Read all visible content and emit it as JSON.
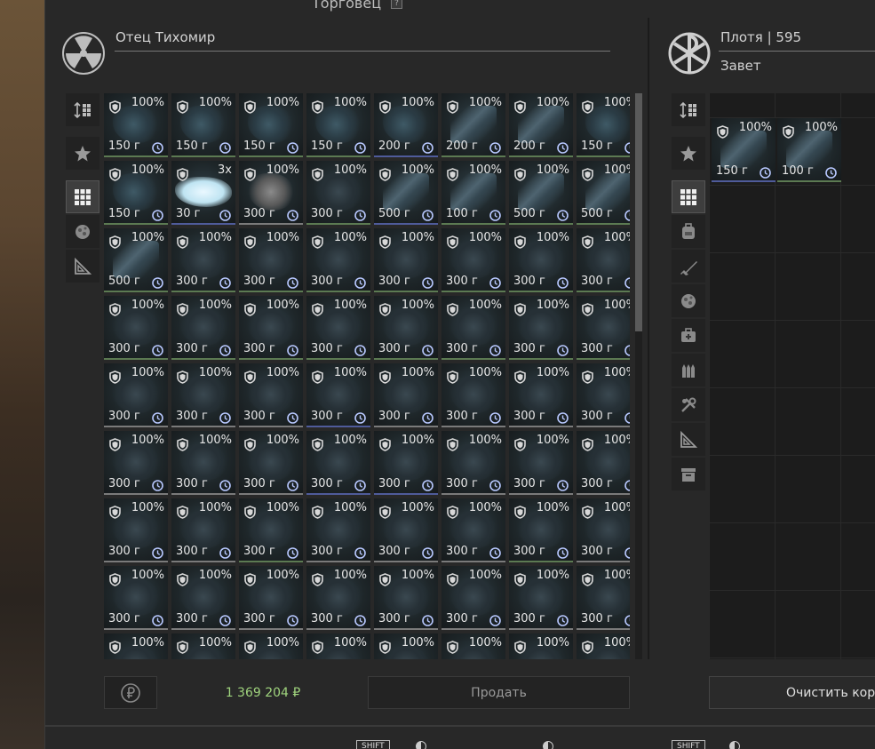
{
  "window": {
    "title": "Торговец",
    "help": "?"
  },
  "trader": {
    "name": "Отец Тихомир"
  },
  "player": {
    "name": "Плотя | 595",
    "faction": "Завет"
  },
  "colors": {
    "money": "#9fd37d",
    "rarity_green": "#5c7a52",
    "rarity_blue": "#4f5b9a"
  },
  "trader_tabs": [
    {
      "icon": "sort-icon",
      "active": false
    },
    {
      "icon": "star-badge-icon",
      "active": false
    },
    {
      "icon": "grid-icon",
      "active": true
    },
    {
      "icon": "artifact-icon",
      "active": false
    },
    {
      "icon": "ruler-triangle-icon",
      "active": false
    }
  ],
  "player_tabs": [
    {
      "icon": "sort-icon",
      "active": false
    },
    {
      "icon": "star-badge-icon",
      "active": false
    },
    {
      "icon": "grid-icon",
      "active": true
    },
    {
      "icon": "backpack-icon",
      "active": false
    },
    {
      "icon": "rifle-icon",
      "active": false
    },
    {
      "icon": "artifact-icon",
      "active": false
    },
    {
      "icon": "medkit-icon",
      "active": false
    },
    {
      "icon": "ammo-icon",
      "active": false
    },
    {
      "icon": "tools-icon",
      "active": false
    },
    {
      "icon": "ruler-triangle-icon",
      "active": false
    },
    {
      "icon": "box-icon",
      "active": false
    }
  ],
  "trader_items": [
    {
      "pct": "100%",
      "wt": "150 г",
      "art": "",
      "rar": "green"
    },
    {
      "pct": "100%",
      "wt": "150 г",
      "art": "",
      "rar": "green"
    },
    {
      "pct": "100%",
      "wt": "150 г",
      "art": "",
      "rar": "green"
    },
    {
      "pct": "100%",
      "wt": "150 г",
      "art": "",
      "rar": "green"
    },
    {
      "pct": "100%",
      "wt": "200 г",
      "art": "",
      "rar": "blue"
    },
    {
      "pct": "100%",
      "wt": "200 г",
      "art": "blade",
      "rar": "green"
    },
    {
      "pct": "100%",
      "wt": "200 г",
      "art": "blade",
      "rar": "green"
    },
    {
      "pct": "100%",
      "wt": "150 г",
      "art": "",
      "rar": "green"
    },
    {
      "pct": "100%",
      "wt": "150 г",
      "art": "",
      "rar": "green"
    },
    {
      "pct": "3x",
      "wt": "30 г",
      "art": "salt",
      "rar": "blue"
    },
    {
      "pct": "100%",
      "wt": "300 г",
      "art": "haze",
      "rar": "white"
    },
    {
      "pct": "100%",
      "wt": "300 г",
      "art": "dark",
      "rar": "green"
    },
    {
      "pct": "100%",
      "wt": "500 г",
      "art": "blade",
      "rar": "blue"
    },
    {
      "pct": "100%",
      "wt": "100 г",
      "art": "blade",
      "rar": "green"
    },
    {
      "pct": "100%",
      "wt": "500 г",
      "art": "blade",
      "rar": "green"
    },
    {
      "pct": "100%",
      "wt": "500 г",
      "art": "blade",
      "rar": "green"
    },
    {
      "pct": "100%",
      "wt": "500 г",
      "art": "blade",
      "rar": "green"
    },
    {
      "pct": "100%",
      "wt": "300 г",
      "art": "dark",
      "rar": "green"
    },
    {
      "pct": "100%",
      "wt": "300 г",
      "art": "dark",
      "rar": "green"
    },
    {
      "pct": "100%",
      "wt": "300 г",
      "art": "dark",
      "rar": "green"
    },
    {
      "pct": "100%",
      "wt": "300 г",
      "art": "dark",
      "rar": "green"
    },
    {
      "pct": "100%",
      "wt": "300 г",
      "art": "dark",
      "rar": "green"
    },
    {
      "pct": "100%",
      "wt": "300 г",
      "art": "dark",
      "rar": "green"
    },
    {
      "pct": "100%",
      "wt": "300 г",
      "art": "dark",
      "rar": "green"
    },
    {
      "pct": "100%",
      "wt": "300 г",
      "art": "dark",
      "rar": "green"
    },
    {
      "pct": "100%",
      "wt": "300 г",
      "art": "dark",
      "rar": "green"
    },
    {
      "pct": "100%",
      "wt": "300 г",
      "art": "dark",
      "rar": "green"
    },
    {
      "pct": "100%",
      "wt": "300 г",
      "art": "dark",
      "rar": "green"
    },
    {
      "pct": "100%",
      "wt": "300 г",
      "art": "dark",
      "rar": "green"
    },
    {
      "pct": "100%",
      "wt": "300 г",
      "art": "dark",
      "rar": "green"
    },
    {
      "pct": "100%",
      "wt": "300 г",
      "art": "dark",
      "rar": "green"
    },
    {
      "pct": "100%",
      "wt": "300 г",
      "art": "dark",
      "rar": "green"
    },
    {
      "pct": "100%",
      "wt": "300 г",
      "art": "dark",
      "rar": "white"
    },
    {
      "pct": "100%",
      "wt": "300 г",
      "art": "dark",
      "rar": "white"
    },
    {
      "pct": "100%",
      "wt": "300 г",
      "art": "dark",
      "rar": "white"
    },
    {
      "pct": "100%",
      "wt": "300 г",
      "art": "dark",
      "rar": "blue"
    },
    {
      "pct": "100%",
      "wt": "300 г",
      "art": "dark",
      "rar": "white"
    },
    {
      "pct": "100%",
      "wt": "300 г",
      "art": "dark",
      "rar": "white"
    },
    {
      "pct": "100%",
      "wt": "300 г",
      "art": "dark",
      "rar": "white"
    },
    {
      "pct": "100%",
      "wt": "300 г",
      "art": "dark",
      "rar": "white"
    },
    {
      "pct": "100%",
      "wt": "300 г",
      "art": "dark",
      "rar": "white"
    },
    {
      "pct": "100%",
      "wt": "300 г",
      "art": "dark",
      "rar": "white"
    },
    {
      "pct": "100%",
      "wt": "300 г",
      "art": "dark",
      "rar": "white"
    },
    {
      "pct": "100%",
      "wt": "300 г",
      "art": "dark",
      "rar": "blue"
    },
    {
      "pct": "100%",
      "wt": "300 г",
      "art": "dark",
      "rar": "blue"
    },
    {
      "pct": "100%",
      "wt": "300 г",
      "art": "dark",
      "rar": "white"
    },
    {
      "pct": "100%",
      "wt": "300 г",
      "art": "dark",
      "rar": "white"
    },
    {
      "pct": "100%",
      "wt": "300 г",
      "art": "dark",
      "rar": "white"
    },
    {
      "pct": "100%",
      "wt": "300 г",
      "art": "dark",
      "rar": "white"
    },
    {
      "pct": "100%",
      "wt": "300 г",
      "art": "dark",
      "rar": "white"
    },
    {
      "pct": "100%",
      "wt": "300 г",
      "art": "dark",
      "rar": "green"
    },
    {
      "pct": "100%",
      "wt": "300 г",
      "art": "dark",
      "rar": "white"
    },
    {
      "pct": "100%",
      "wt": "300 г",
      "art": "dark",
      "rar": "white"
    },
    {
      "pct": "100%",
      "wt": "300 г",
      "art": "dark",
      "rar": "white"
    },
    {
      "pct": "100%",
      "wt": "300 г",
      "art": "dark",
      "rar": "green"
    },
    {
      "pct": "100%",
      "wt": "300 г",
      "art": "dark",
      "rar": "white"
    },
    {
      "pct": "100%",
      "wt": "300 г",
      "art": "dark",
      "rar": "white"
    },
    {
      "pct": "100%",
      "wt": "300 г",
      "art": "dark",
      "rar": "white"
    },
    {
      "pct": "100%",
      "wt": "300 г",
      "art": "dark",
      "rar": "white"
    },
    {
      "pct": "100%",
      "wt": "300 г",
      "art": "dark",
      "rar": "white"
    },
    {
      "pct": "100%",
      "wt": "300 г",
      "art": "dark",
      "rar": "white"
    },
    {
      "pct": "100%",
      "wt": "300 г",
      "art": "dark",
      "rar": "white"
    },
    {
      "pct": "100%",
      "wt": "300 г",
      "art": "dark",
      "rar": "white"
    },
    {
      "pct": "100%",
      "wt": "300 г",
      "art": "dark",
      "rar": "white"
    },
    {
      "pct": "100%",
      "wt": "",
      "art": "dark",
      "rar": "white"
    },
    {
      "pct": "100%",
      "wt": "",
      "art": "dark",
      "rar": "white"
    },
    {
      "pct": "100%",
      "wt": "",
      "art": "dark",
      "rar": "white"
    },
    {
      "pct": "100%",
      "wt": "",
      "art": "dark",
      "rar": "white"
    },
    {
      "pct": "100%",
      "wt": "",
      "art": "dark",
      "rar": "white"
    },
    {
      "pct": "100%",
      "wt": "",
      "art": "dark",
      "rar": "white"
    },
    {
      "pct": "100%",
      "wt": "",
      "art": "dark",
      "rar": "white"
    },
    {
      "pct": "100%",
      "wt": "",
      "art": "dark",
      "rar": "white"
    }
  ],
  "player_items": [
    {
      "pct": "100%",
      "wt": "150 г",
      "art": "blade",
      "rar": "blue"
    },
    {
      "pct": "100%",
      "wt": "100 г",
      "art": "blade",
      "rar": "green"
    }
  ],
  "footer": {
    "money": "1 369 204 ₽",
    "sell_label": "Продать",
    "clear_label": "Очистить корзину",
    "shift_key": "SHIFT"
  }
}
